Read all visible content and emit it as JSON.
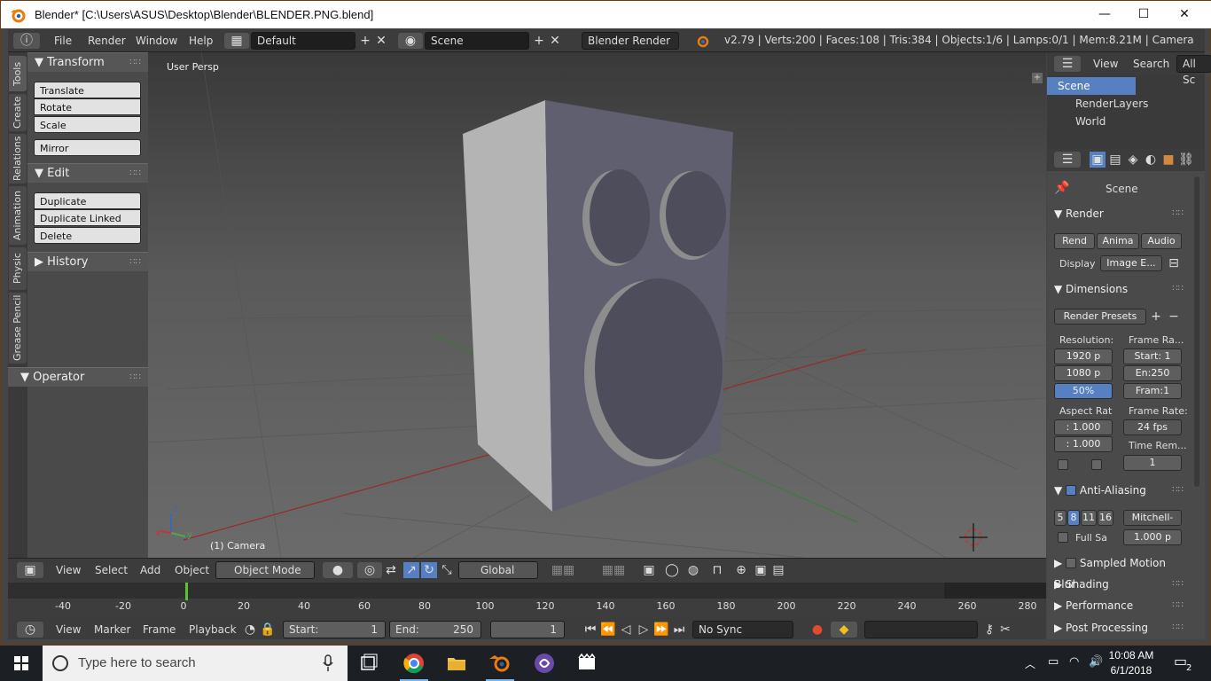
{
  "window": {
    "title": "Blender* [C:\\Users\\ASUS\\Desktop\\Blender\\BLENDER.PNG.blend]",
    "minimize": "—",
    "maximize": "☐",
    "close": "✕"
  },
  "topbar": {
    "menus": [
      "File",
      "Render",
      "Window",
      "Help"
    ],
    "layout": "Default",
    "scene": "Scene",
    "engine": "Blender Render",
    "stats": "v2.79 | Verts:200 | Faces:108 | Tris:384 | Objects:1/6 | Lamps:0/1 | Mem:8.21M | Camera"
  },
  "tabs": [
    "Tools",
    "Create",
    "Relations",
    "Animation",
    "Physic",
    "Grease Pencil"
  ],
  "toolshelf": {
    "transform_title": "Transform",
    "transform_buttons": [
      "Translate",
      "Rotate",
      "Scale"
    ],
    "mirror": "Mirror",
    "edit_title": "Edit",
    "edit_buttons": [
      "Duplicate",
      "Duplicate Linked",
      "Delete"
    ],
    "history_title": "History",
    "operator_title": "Operator"
  },
  "viewport": {
    "label": "User Persp",
    "object_label": "(1) Camera",
    "axis_x": "x",
    "axis_y": "y",
    "axis_z": "z"
  },
  "view3d_header": {
    "menus": [
      "View",
      "Select",
      "Add",
      "Object"
    ],
    "mode": "Object Mode",
    "orientation": "Global"
  },
  "timeline": {
    "ticks": [
      "-40",
      "-20",
      "0",
      "20",
      "40",
      "60",
      "80",
      "100",
      "120",
      "140",
      "160",
      "180",
      "200",
      "220",
      "240",
      "260",
      "280"
    ],
    "current_frame_marker": 0
  },
  "tl_header": {
    "menus": [
      "View",
      "Marker",
      "Frame",
      "Playback"
    ],
    "start_label": "Start:",
    "start_value": "1",
    "end_label": "End:",
    "end_value": "250",
    "current": "1",
    "sync": "No Sync"
  },
  "outliner": {
    "view": "View",
    "search": "Search",
    "all": "All Sc",
    "items": [
      "Scene",
      "RenderLayers",
      "World"
    ]
  },
  "properties": {
    "context": "Scene",
    "render_title": "Render",
    "render_btn": "Rend",
    "anim_btn": "Anima",
    "audio_btn": "Audio",
    "display_label": "Display",
    "display_value": "Image E...",
    "dimensions_title": "Dimensions",
    "presets": "Render Presets",
    "resolution_label": "Resolution:",
    "res_x": "1920 p",
    "res_y": "1080 p",
    "res_pct": "50%",
    "frame_range_label": "Frame Ra...",
    "start": "Start: 1",
    "end": "En:250",
    "frame": "Fram:1",
    "aspect_label": "Aspect Rat",
    "aspect_x": ": 1.000",
    "aspect_y": ": 1.000",
    "frame_rate_label": "Frame Rate:",
    "fps": "24 fps",
    "time_remap_label": "Time Rem...",
    "time_remap_value": "1",
    "aa_title": "Anti-Aliasing",
    "aa_samples": [
      "5",
      "8",
      "11",
      "16"
    ],
    "aa_filter": "Mitchell-",
    "full_sample": "Full Sa",
    "filter_size": "1.000 p",
    "sampled_motion": "Sampled Motion Blur",
    "shading": "Shading",
    "performance": "Performance",
    "post_processing": "Post Processing"
  },
  "taskbar": {
    "search_placeholder": "Type here to search",
    "time": "10:08 AM",
    "date": "6/1/2018",
    "notifications": "2"
  },
  "colors": {
    "accent_blue": "#5680c2",
    "blender_orange": "#e87d0d",
    "timeline_cursor": "#57c435"
  }
}
